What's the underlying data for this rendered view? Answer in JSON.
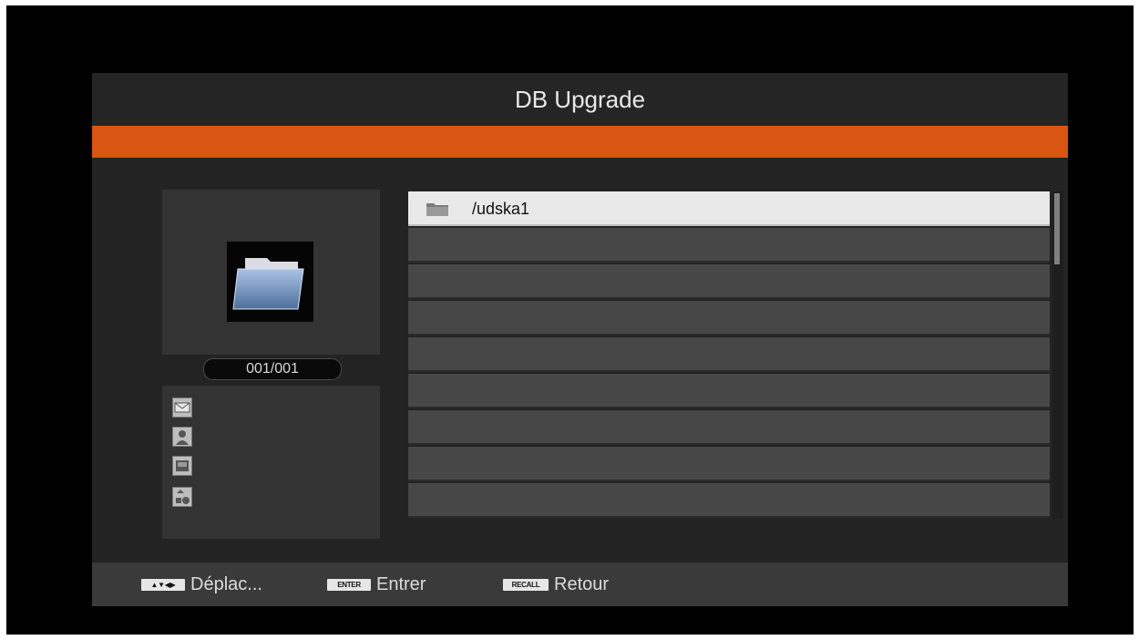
{
  "window": {
    "title": "DB Upgrade"
  },
  "preview": {
    "counter": "001/001",
    "folder_icon": "folder-icon"
  },
  "media_types": [
    "mail-icon",
    "person-icon",
    "picture-icon",
    "shapes-icon"
  ],
  "file_list": {
    "rows": [
      {
        "label": "/udska1",
        "icon": "folder-icon",
        "selected": true
      },
      {
        "label": ""
      },
      {
        "label": ""
      },
      {
        "label": ""
      },
      {
        "label": ""
      },
      {
        "label": ""
      },
      {
        "label": ""
      },
      {
        "label": ""
      },
      {
        "label": ""
      }
    ]
  },
  "footer": {
    "hints": [
      {
        "key": "▲▼◀▶",
        "label": "Déplac..."
      },
      {
        "key": "ENTER",
        "label": "Entrer"
      },
      {
        "key": "RECALL",
        "label": "Retour"
      }
    ]
  },
  "colors": {
    "accent": "#d85612",
    "row": "#474747",
    "selected_row": "#e9e9e9"
  }
}
